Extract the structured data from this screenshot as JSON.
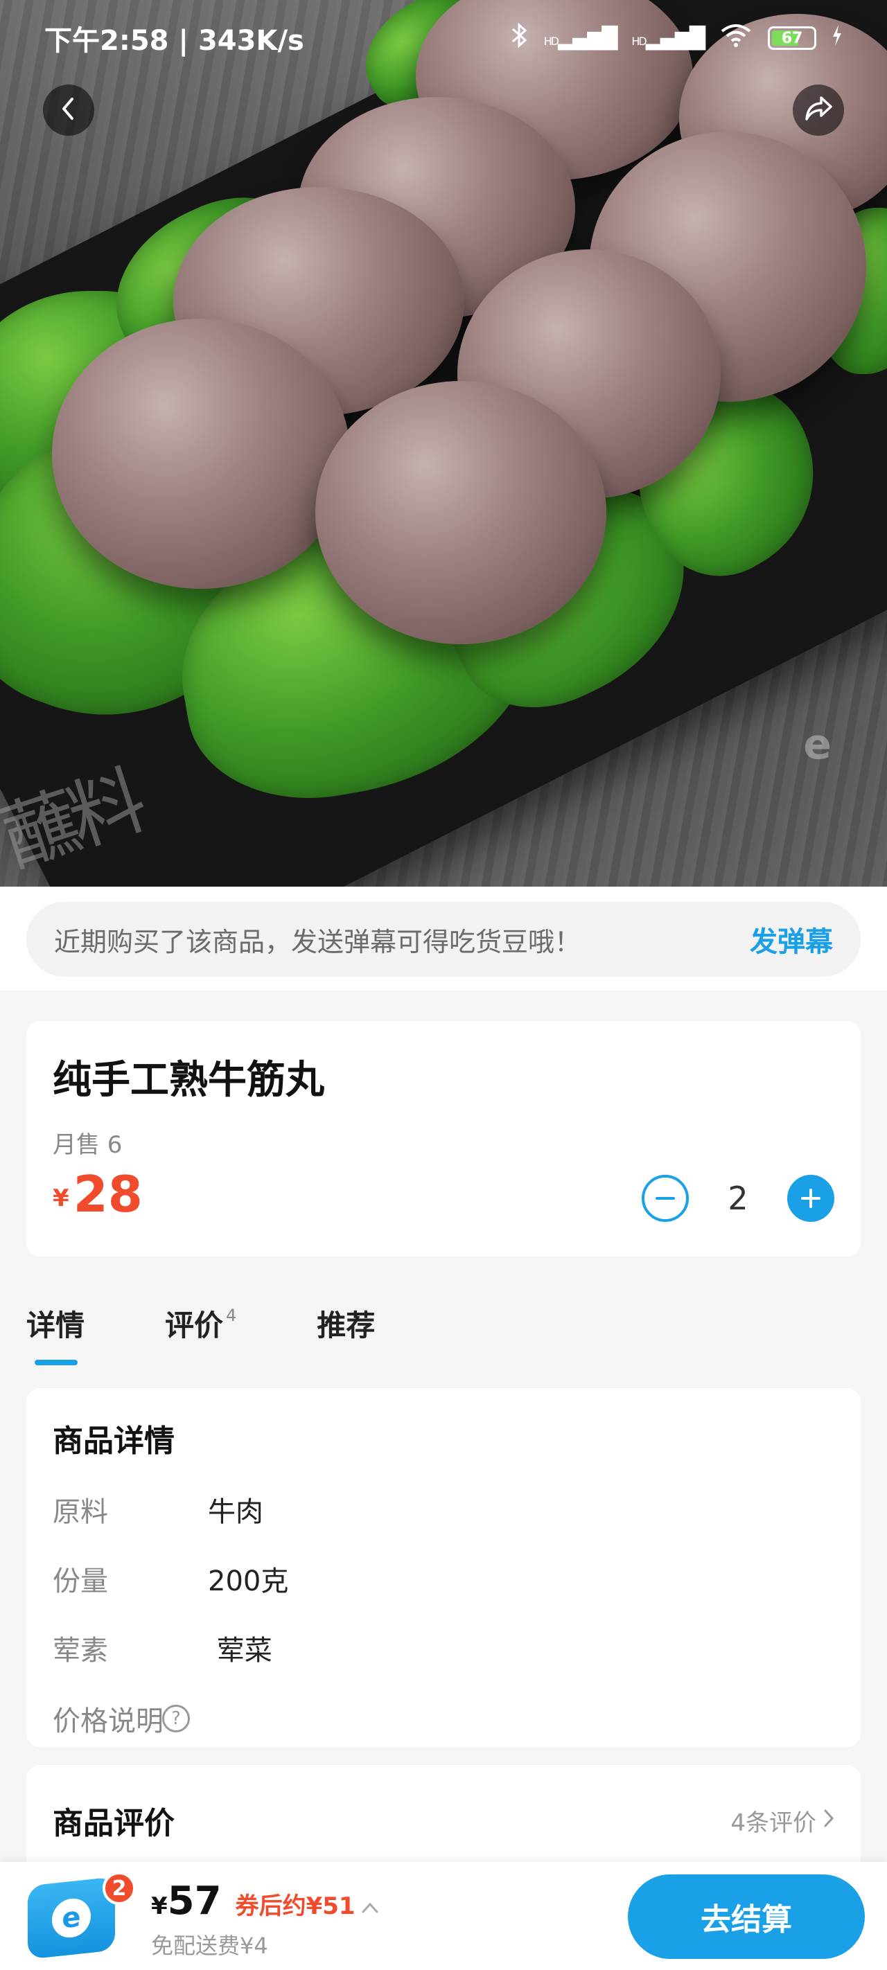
{
  "status_bar": {
    "time_speed": "下午2:58 | 343K/s",
    "bluetooth_icon": "bluetooth-icon",
    "signal_1": "HD",
    "signal_2": "HD",
    "battery": "67"
  },
  "hero": {
    "image_subject": "beef-tendon-balls-on-lettuce",
    "watermark": "e"
  },
  "nav": {
    "back_icon": "chevron-left-icon",
    "share_icon": "share-icon"
  },
  "danmaku": {
    "prompt": "近期购买了该商品，发送弹幕可得吃货豆哦！",
    "button": "发弹幕"
  },
  "product": {
    "title": "纯手工熟牛筋丸",
    "monthly_sales": "月售 6",
    "currency": "¥",
    "price": "28",
    "quantity": "2"
  },
  "tabs": [
    {
      "label": "详情",
      "badge": ""
    },
    {
      "label": "评价",
      "badge": "4"
    },
    {
      "label": "推荐",
      "badge": ""
    }
  ],
  "details": {
    "title": "商品详情",
    "rows": [
      {
        "key": "原料",
        "value": "牛肉"
      },
      {
        "key": "份量",
        "value": "200克"
      },
      {
        "key": "荤素",
        "value": " 荤菜"
      },
      {
        "key": "价格说明",
        "value": ""
      }
    ]
  },
  "reviews": {
    "title": "商品评价",
    "count_link": "4条评价"
  },
  "bottom_bar": {
    "cart_badge": "2",
    "currency": "¥",
    "total": "57",
    "coupon_text": "券后约¥51",
    "delivery": "免配送费¥4",
    "checkout": "去结算"
  },
  "colors": {
    "accent": "#1aa0e6",
    "price": "#f04b2c"
  }
}
